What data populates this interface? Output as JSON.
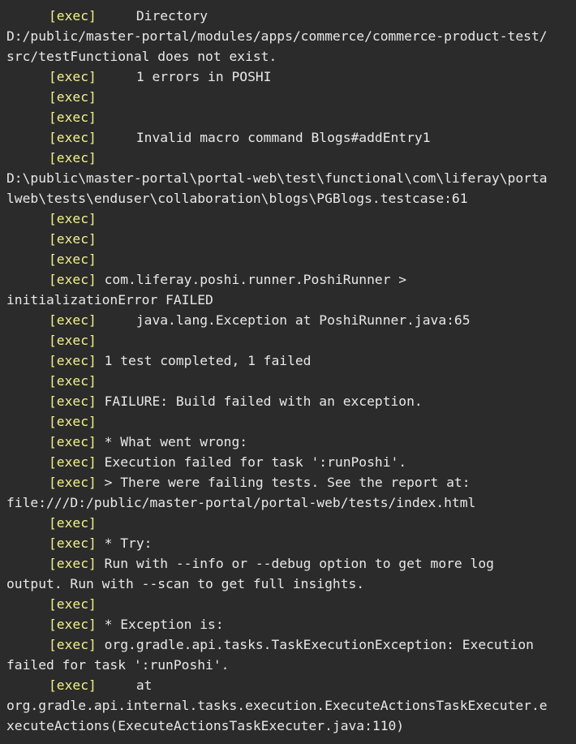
{
  "console": {
    "exec_tag": "[exec]",
    "lines": [
      {
        "tag": true,
        "text": "     Directory"
      },
      {
        "tag": false,
        "text": "D:/public/master-portal/modules/apps/commerce/commerce-product-test/"
      },
      {
        "tag": false,
        "text": "src/testFunctional does not exist."
      },
      {
        "tag": true,
        "text": "     1 errors in POSHI"
      },
      {
        "tag": true,
        "text": ""
      },
      {
        "tag": true,
        "text": ""
      },
      {
        "tag": true,
        "text": "     Invalid macro command Blogs#addEntry1"
      },
      {
        "tag": true,
        "text": ""
      },
      {
        "tag": false,
        "text": "D:\\public\\master-portal\\portal-web\\test\\functional\\com\\liferay\\porta"
      },
      {
        "tag": false,
        "text": "lweb\\tests\\enduser\\collaboration\\blogs\\PGBlogs.testcase:61"
      },
      {
        "tag": true,
        "text": ""
      },
      {
        "tag": true,
        "text": ""
      },
      {
        "tag": true,
        "text": ""
      },
      {
        "tag": true,
        "text": " com.liferay.poshi.runner.PoshiRunner >"
      },
      {
        "tag": false,
        "text": "initializationError FAILED"
      },
      {
        "tag": true,
        "text": "     java.lang.Exception at PoshiRunner.java:65"
      },
      {
        "tag": true,
        "text": ""
      },
      {
        "tag": true,
        "text": " 1 test completed, 1 failed"
      },
      {
        "tag": true,
        "text": ""
      },
      {
        "tag": true,
        "text": " FAILURE: Build failed with an exception."
      },
      {
        "tag": true,
        "text": ""
      },
      {
        "tag": true,
        "text": " * What went wrong:"
      },
      {
        "tag": true,
        "text": " Execution failed for task ':runPoshi'."
      },
      {
        "tag": true,
        "text": " > There were failing tests. See the report at:"
      },
      {
        "tag": false,
        "text": "file:///D:/public/master-portal/portal-web/tests/index.html"
      },
      {
        "tag": true,
        "text": ""
      },
      {
        "tag": true,
        "text": " * Try:"
      },
      {
        "tag": true,
        "text": " Run with --info or --debug option to get more log"
      },
      {
        "tag": false,
        "text": "output. Run with --scan to get full insights."
      },
      {
        "tag": true,
        "text": ""
      },
      {
        "tag": true,
        "text": " * Exception is:"
      },
      {
        "tag": true,
        "text": " org.gradle.api.tasks.TaskExecutionException: Execution"
      },
      {
        "tag": false,
        "text": "failed for task ':runPoshi'."
      },
      {
        "tag": true,
        "text": "     at"
      },
      {
        "tag": false,
        "text": "org.gradle.api.internal.tasks.execution.ExecuteActionsTaskExecuter.e"
      },
      {
        "tag": false,
        "text": "xecuteActions(ExecuteActionsTaskExecuter.java:110)"
      }
    ]
  }
}
